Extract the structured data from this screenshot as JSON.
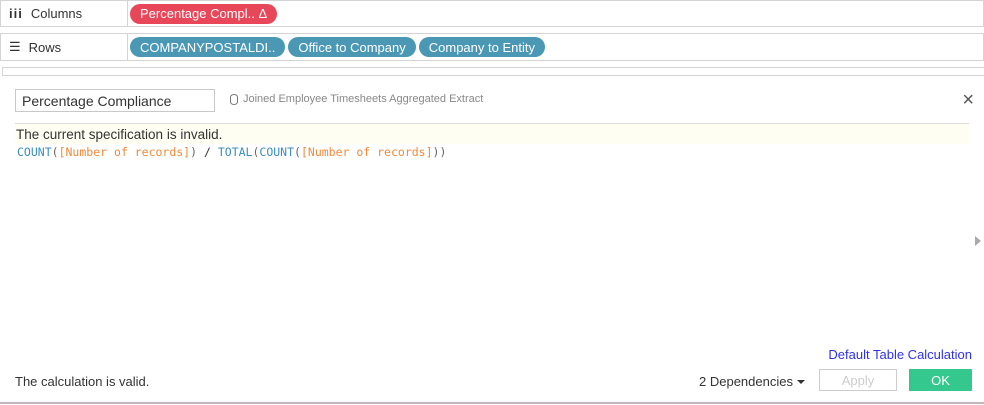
{
  "shelves": {
    "columns": {
      "label": "Columns",
      "pills": [
        {
          "label": "Percentage Compl.. Δ"
        }
      ]
    },
    "rows": {
      "label": "Rows",
      "pills": [
        {
          "label": "COMPANYPOSTALDI.."
        },
        {
          "label": "Office to Company"
        },
        {
          "label": "Company to Entity"
        }
      ]
    }
  },
  "dialog": {
    "name_value": "Percentage Compliance",
    "datasource": "Joined Employee Timesheets Aggregated Extract",
    "error_message": "The current specification is invalid.",
    "formula": {
      "count1": "COUNT",
      "open1": "(",
      "field1": "[Number of records]",
      "close1": ")",
      "op": " / ",
      "total": "TOTAL",
      "open2": "(",
      "count2": "COUNT",
      "open3": "(",
      "field2": "[Number of records]",
      "close2": "))"
    },
    "default_table_calc": "Default Table Calculation",
    "status": "The calculation is valid.",
    "dependencies": "2 Dependencies",
    "apply": "Apply",
    "ok": "OK",
    "close_icon": "×"
  }
}
